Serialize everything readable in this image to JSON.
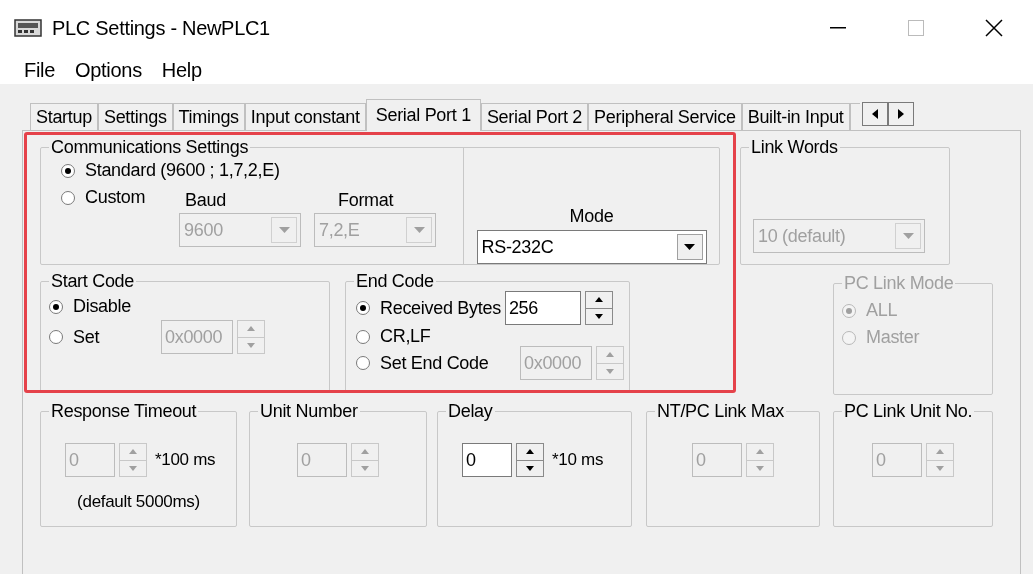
{
  "window": {
    "title": "PLC Settings - NewPLC1"
  },
  "menu": [
    {
      "label": "File"
    },
    {
      "label": "Options"
    },
    {
      "label": "Help"
    }
  ],
  "tabs": [
    {
      "label": "Startup",
      "selected": false
    },
    {
      "label": "Settings",
      "selected": false
    },
    {
      "label": "Timings",
      "selected": false
    },
    {
      "label": "Input constant",
      "selected": false
    },
    {
      "label": "Serial Port 1",
      "selected": true
    },
    {
      "label": "Serial Port 2",
      "selected": false
    },
    {
      "label": "Peripheral Service",
      "selected": false
    },
    {
      "label": "Built-in Input",
      "selected": false
    }
  ],
  "communications": {
    "legend": "Communications Settings",
    "options": [
      {
        "label": "Standard (9600 ; 1,7,2,E)",
        "selected": true
      },
      {
        "label": "Custom",
        "selected": false
      }
    ],
    "baud": {
      "label": "Baud",
      "value": "9600",
      "disabled": true
    },
    "format": {
      "label": "Format",
      "value": "7,2,E",
      "disabled": true
    },
    "mode": {
      "label": "Mode",
      "value": "RS-232C",
      "disabled": false
    }
  },
  "link_words": {
    "legend": "Link Words",
    "value": "10 (default)",
    "disabled": true
  },
  "start_code": {
    "legend": "Start Code",
    "options": [
      {
        "label": "Disable",
        "selected": true
      },
      {
        "label": "Set",
        "selected": false
      }
    ],
    "code": {
      "value": "0x0000",
      "disabled": true
    }
  },
  "end_code": {
    "legend": "End Code",
    "options": [
      {
        "label": "Received Bytes",
        "selected": true
      },
      {
        "label": "CR,LF",
        "selected": false
      },
      {
        "label": "Set End Code",
        "selected": false
      }
    ],
    "received_bytes": {
      "value": "256",
      "disabled": false
    },
    "end_code_value": {
      "value": "0x0000",
      "disabled": true
    }
  },
  "pc_link_mode": {
    "legend": "PC Link Mode",
    "disabled": true,
    "options": [
      {
        "label": "ALL",
        "selected": true
      },
      {
        "label": "Master",
        "selected": false
      }
    ]
  },
  "timing_groups": [
    {
      "legend": "Response Timeout",
      "value": "0",
      "disabled": true,
      "unit": "*100 ms",
      "note": "(default 5000ms)"
    },
    {
      "legend": "Unit Number",
      "value": "0",
      "disabled": true
    },
    {
      "legend": "Delay",
      "value": "0",
      "disabled": false,
      "unit": "*10 ms"
    },
    {
      "legend": "NT/PC Link Max",
      "value": "0",
      "disabled": true
    },
    {
      "legend": "PC Link Unit No.",
      "value": "0",
      "disabled": true
    }
  ]
}
